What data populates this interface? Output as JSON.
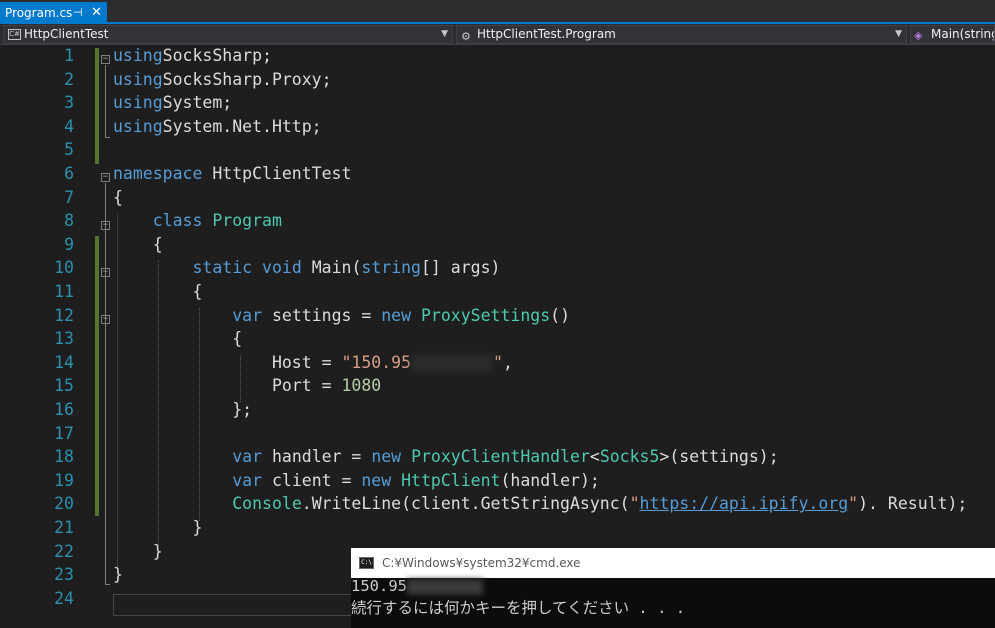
{
  "tab": {
    "label": "Program.cs",
    "pin": "⊣",
    "close": "✕"
  },
  "navbar": {
    "project": {
      "icon": "C#",
      "label": "HttpClientTest"
    },
    "type": {
      "label": "HttpClientTest.Program"
    },
    "member": {
      "label": "Main(string[] args)"
    }
  },
  "editor": {
    "lines": [
      {
        "n": "1",
        "segs": [
          [
            "kw",
            "using"
          ],
          [
            "",
            "SocksSharp;"
          ]
        ]
      },
      {
        "n": "2",
        "segs": [
          [
            "kw",
            "using"
          ],
          [
            "",
            "SocksSharp.Proxy;"
          ]
        ]
      },
      {
        "n": "3",
        "segs": [
          [
            "kw",
            "using"
          ],
          [
            "",
            "System;"
          ]
        ]
      },
      {
        "n": "4",
        "segs": [
          [
            "kw",
            "using"
          ],
          [
            "",
            "System.Net.Http;"
          ]
        ]
      },
      {
        "n": "5",
        "segs": []
      },
      {
        "n": "6",
        "segs": [
          [
            "kw",
            "namespace"
          ],
          [
            "",
            " HttpClientTest"
          ]
        ]
      },
      {
        "n": "7",
        "segs": [
          [
            "",
            "{"
          ]
        ]
      },
      {
        "n": "8",
        "segs": [
          [
            "",
            "    "
          ],
          [
            "kw",
            "class"
          ],
          [
            "",
            " "
          ],
          [
            "ty",
            "Program"
          ]
        ]
      },
      {
        "n": "9",
        "segs": [
          [
            "",
            "    {"
          ]
        ]
      },
      {
        "n": "10",
        "segs": [
          [
            "",
            "        "
          ],
          [
            "kw",
            "static"
          ],
          [
            "",
            " "
          ],
          [
            "kw",
            "void"
          ],
          [
            "",
            " Main("
          ],
          [
            "kw",
            "string"
          ],
          [
            "",
            "[] args)"
          ]
        ]
      },
      {
        "n": "11",
        "segs": [
          [
            "",
            "        {"
          ]
        ]
      },
      {
        "n": "12",
        "segs": [
          [
            "",
            "            "
          ],
          [
            "kw",
            "var"
          ],
          [
            "",
            " settings = "
          ],
          [
            "kw",
            "new"
          ],
          [
            "",
            " "
          ],
          [
            "ty",
            "ProxySettings"
          ],
          [
            "",
            "()"
          ]
        ]
      },
      {
        "n": "13",
        "segs": [
          [
            "",
            "            {"
          ]
        ]
      },
      {
        "n": "14",
        "segs": [
          [
            "",
            "                Host = "
          ],
          [
            "st",
            "\"150.95"
          ],
          [
            "blur",
            ""
          ],
          [
            "st",
            "\""
          ],
          [
            "",
            ","
          ]
        ]
      },
      {
        "n": "15",
        "segs": [
          [
            "",
            "                Port = "
          ],
          [
            "nm",
            "1080"
          ]
        ]
      },
      {
        "n": "16",
        "segs": [
          [
            "",
            "            };"
          ]
        ]
      },
      {
        "n": "17",
        "segs": []
      },
      {
        "n": "18",
        "segs": [
          [
            "",
            "            "
          ],
          [
            "kw",
            "var"
          ],
          [
            "",
            " handler = "
          ],
          [
            "kw",
            "new"
          ],
          [
            "",
            " "
          ],
          [
            "ty",
            "ProxyClientHandler"
          ],
          [
            "",
            "<"
          ],
          [
            "ty",
            "Socks5"
          ],
          [
            "",
            ">(settings);"
          ]
        ]
      },
      {
        "n": "19",
        "segs": [
          [
            "",
            "            "
          ],
          [
            "kw",
            "var"
          ],
          [
            "",
            " client = "
          ],
          [
            "kw",
            "new"
          ],
          [
            "",
            " "
          ],
          [
            "ty",
            "HttpClient"
          ],
          [
            "",
            "(handler);"
          ]
        ]
      },
      {
        "n": "20",
        "segs": [
          [
            "",
            "            "
          ],
          [
            "ty",
            "Console"
          ],
          [
            "",
            ".WriteLine(client.GetStringAsync("
          ],
          [
            "st",
            "\""
          ],
          [
            "url",
            "https://api.ipify.org"
          ],
          [
            "st",
            "\""
          ],
          [
            "",
            "). Result);"
          ]
        ]
      },
      {
        "n": "21",
        "segs": [
          [
            "",
            "        }"
          ]
        ]
      },
      {
        "n": "22",
        "segs": [
          [
            "",
            "    }"
          ]
        ]
      },
      {
        "n": "23",
        "segs": [
          [
            "",
            "}"
          ]
        ]
      },
      {
        "n": "24",
        "segs": []
      }
    ]
  },
  "console": {
    "title": "C:¥Windows¥system32¥cmd.exe",
    "icon": "C:\\",
    "output_line1": "150.95",
    "output_line2": "続行するには何かキーを押してください . . ."
  },
  "colors": {
    "editor_bg": "#1e1e1e",
    "line_number": "#2b91af",
    "keyword": "#569cd6",
    "type": "#4ec9b0",
    "string": "#d69d85",
    "number": "#b5cea8",
    "accent": "#007acc",
    "change_bar": "#577430"
  }
}
